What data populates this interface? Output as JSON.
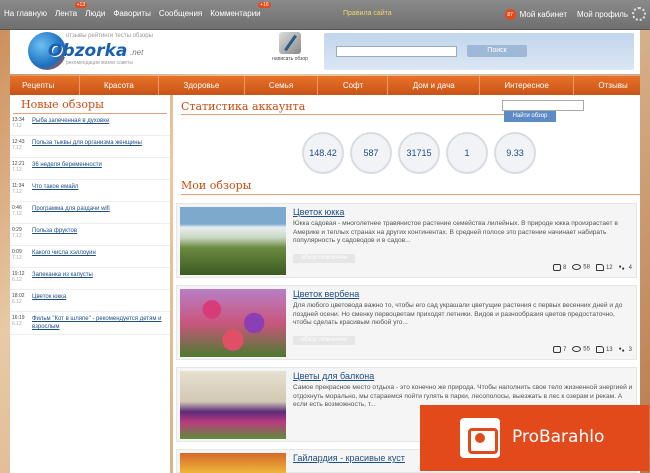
{
  "topnav": {
    "items": [
      {
        "label": "На главную"
      },
      {
        "label": "Лента",
        "badge": "+13"
      },
      {
        "label": "Люди"
      },
      {
        "label": "Фавориты"
      },
      {
        "label": "Сообщения"
      },
      {
        "label": "Комментарии",
        "badge": "+16"
      }
    ],
    "center": "Правила сайта",
    "notify_count": "87",
    "cabinet": "Мой кабинет",
    "profile": "Мой профиль"
  },
  "header": {
    "logo_word": "Obzorka",
    "logo_tags": "отзывы рейтинги тесты обзоры",
    "logo_net": ".net",
    "logo_sub": "рекомендации жизни советы",
    "write_label": "написать обзор",
    "search_button": "Поиск"
  },
  "menu": [
    "Рецепты",
    "Красота",
    "Здоровье",
    "Семья",
    "Софт",
    "Дом и дача",
    "Интересное",
    "Отзывы"
  ],
  "sidebar": {
    "title": "Новые обзоры",
    "items": [
      {
        "time": "13:34",
        "date": "7.12",
        "title": "Рыба запеченная в духовке"
      },
      {
        "time": "12:43",
        "date": "7.12",
        "title": "Польза тыквы для организма женщины"
      },
      {
        "time": "12:21",
        "date": "7.12",
        "title": "36 неделя беременности"
      },
      {
        "time": "11:34",
        "date": "7.12",
        "title": "Что такое емайл"
      },
      {
        "time": "0:46",
        "date": "7.12",
        "title": "Программа для раздачи wifi"
      },
      {
        "time": "0:29",
        "date": "7.12",
        "title": "Польза фруктов"
      },
      {
        "time": "0:09",
        "date": "7.12",
        "title": "Какого числа хэллоуин"
      },
      {
        "time": "19:12",
        "date": "6.12",
        "title": "Запеканка из капусты"
      },
      {
        "time": "18:02",
        "date": "6.12",
        "title": "Цветок юкка"
      },
      {
        "time": "16:19",
        "date": "6.12",
        "title": "Фильм \"Кот в шляпе\" - рекомендуется детям и взрослым"
      }
    ]
  },
  "main": {
    "stats_title": "Статистика аккаунта",
    "find_button": "Найти обзор",
    "stats": [
      "148.42",
      "587",
      "31715",
      "1",
      "9.33"
    ],
    "reviews_title": "Мои обзоры",
    "more_label": "обзор отключен",
    "reviews": [
      {
        "title": "Цветок юкка",
        "text": "Юкка садовая - многолетнее травянистое растение семейства лилейных. В природе юкка произрастает в Америке и теплых странах на других континентах. В средней полосе это растение начинает набирать популярность у садоводов и в садов...",
        "comments": "8",
        "views": "58",
        "likes": "12",
        "shares": "4"
      },
      {
        "title": "Цветок вербена",
        "text": "Для любого цветовода важно то, чтобы его сад украшали цветущие растения с первых весенних дней и до поздней осени. Но сменку первоцветам приходят летники. Видов и разнообразия цветов предостаточно, чтобы сделать красивым любой уго...",
        "comments": "7",
        "views": "55",
        "likes": "13",
        "shares": "3"
      },
      {
        "title": "Цветы для балкона",
        "text": "Самое прекрасное место отдыха - это конечно же природа. Чтобы наполнить свое тело жизненной энергией и отдохнуть морально, мы стараемся пойти гулять в парки, лесополосы, выезжать в лес к озерам и рекам. А если есть возможность, т...",
        "comments": "",
        "views": "",
        "likes": "",
        "shares": ""
      },
      {
        "title": "Гайлардия - красивые куст",
        "text": "",
        "comments": "",
        "views": "",
        "likes": "",
        "shares": ""
      }
    ]
  },
  "ad": {
    "label": "ProBarahlo"
  }
}
